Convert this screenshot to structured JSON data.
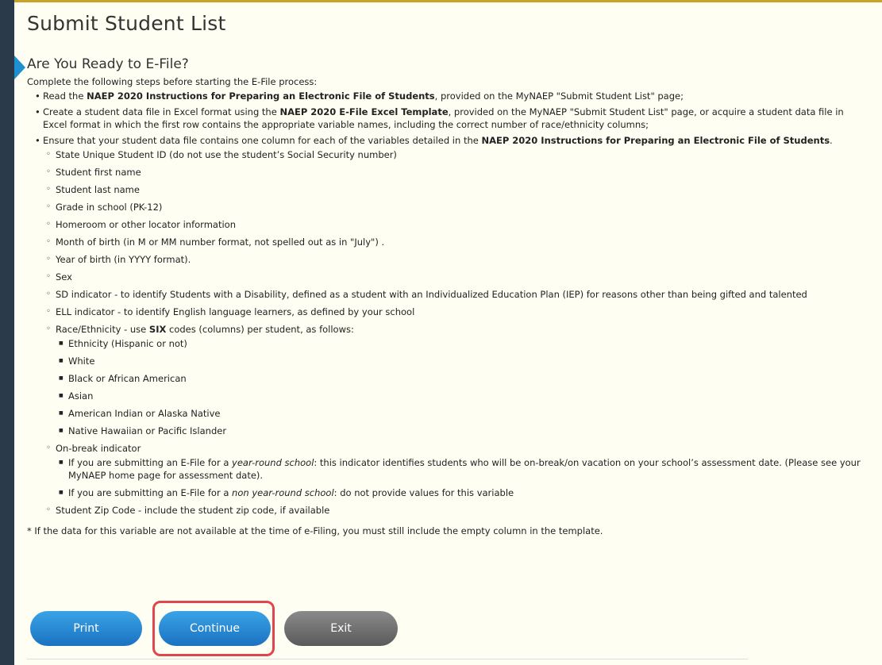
{
  "page": {
    "title": "Submit Student List",
    "subtitle": "Are You Ready to E-File?",
    "intro": "Complete the following steps before starting the E-File process:"
  },
  "steps": {
    "read": {
      "pre": "Read the ",
      "bold": "NAEP 2020 Instructions for Preparing an Electronic File of Students",
      "post": ", provided on the MyNAEP \"Submit Student List\" page;"
    },
    "create": {
      "pre": "Create a student data file in Excel format using the ",
      "bold": "NAEP 2020 E-File Excel Template",
      "post": ", provided on the MyNAEP \"Submit Student List\" page, or acquire a student data file in Excel format in which the first row contains the appropriate variable names, including the correct number of race/ethnicity columns;"
    },
    "ensure": {
      "pre": "Ensure that your student data file contains one column for each of the variables detailed in the ",
      "bold": "NAEP 2020 Instructions for Preparing an Electronic File of Students",
      "post": "."
    }
  },
  "variables": {
    "state_id": "State Unique Student ID (do not use the student’s Social Security number)",
    "first_name": "Student first name",
    "last_name": "Student last name",
    "grade": "Grade in school (PK-12)",
    "homeroom": "Homeroom or other locator information",
    "month_birth": "Month of birth (in M or MM number format, not spelled out as in \"July\") .",
    "year_birth": "Year of birth (in YYYY format).",
    "sex": "Sex",
    "sd": "SD indicator - to identify Students with a Disability, defined as a student with an Individualized Education Plan (IEP) for reasons other than being gifted and talented",
    "ell": "ELL indicator - to identify English language learners, as defined by your school",
    "race_pre": "Race/Ethnicity - use ",
    "race_bold": "SIX",
    "race_post": " codes (columns) per student, as follows:",
    "race_items": [
      "Ethnicity (Hispanic or not)",
      "White",
      "Black or African American",
      "Asian",
      "American Indian or Alaska Native",
      "Native Hawaiian or Pacific Islander"
    ],
    "onbreak": "On-break indicator",
    "onbreak_yr_pre": "If you are submitting an E-File for a ",
    "onbreak_yr_em": "year-round school",
    "onbreak_yr_post": ": this indicator identifies students who will be on-break/on vacation on your school’s assessment date. (Please see your MyNAEP home page for assessment date).",
    "onbreak_nyr_pre": "If you are submitting an E-File for a ",
    "onbreak_nyr_em": "non year-round school",
    "onbreak_nyr_post": ": do not provide values for this variable",
    "zip": "Student Zip Code - include the student zip code, if available"
  },
  "note": "* If the data for this variable are not available at the time of e-Filing, you must still include the empty column in the template.",
  "buttons": {
    "print": "Print",
    "continue": "Continue",
    "exit": "Exit"
  },
  "colors": {
    "primary_button": "#1b72c2",
    "secondary_button": "#5a5a5a",
    "highlight": "#e0464b",
    "panel_bg": "#fffef2"
  }
}
